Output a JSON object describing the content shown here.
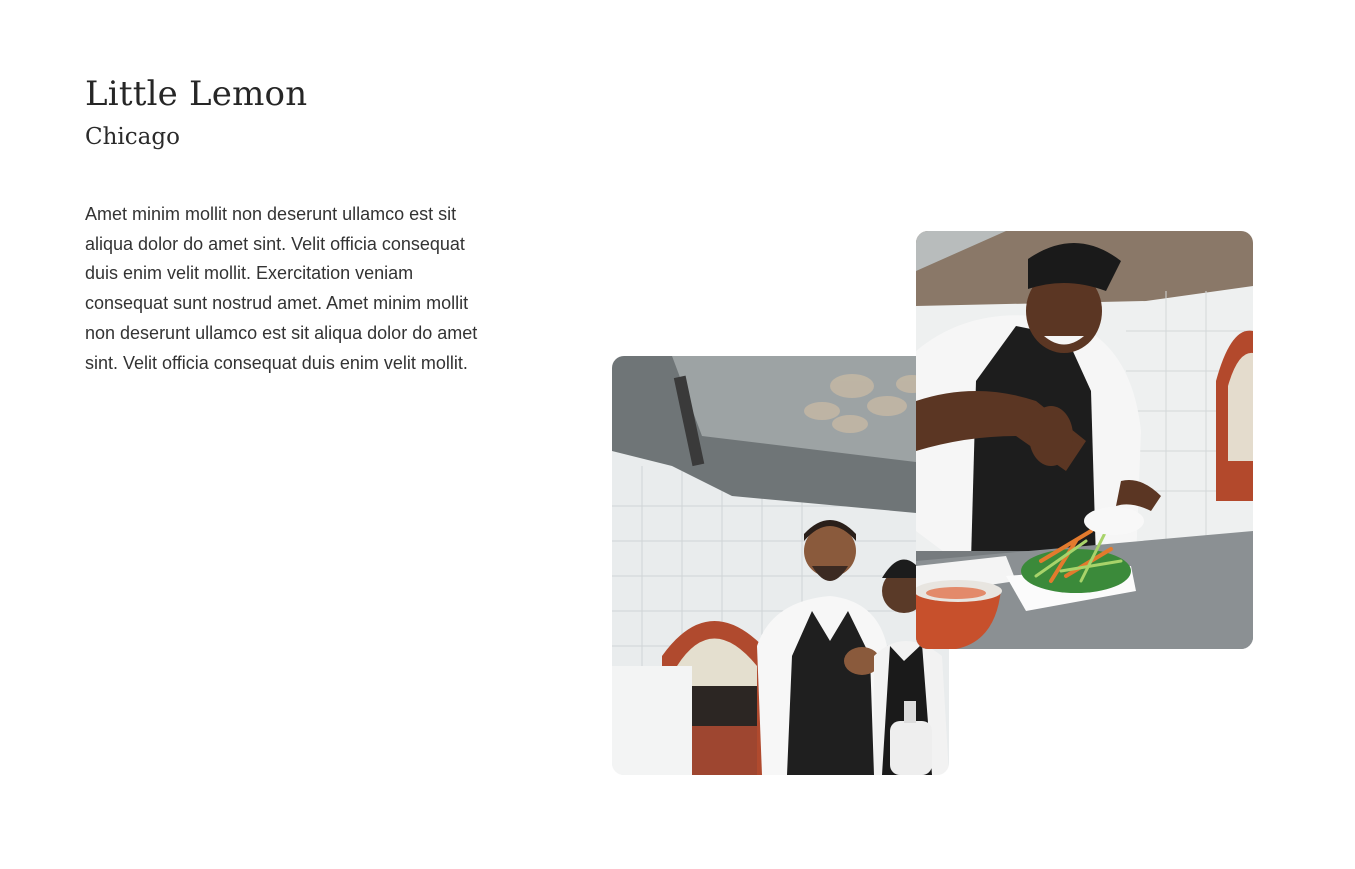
{
  "about": {
    "title": "Little Lemon",
    "subtitle": "Chicago",
    "description": "Amet minim mollit non deserunt ullamco est sit aliqua dolor do amet sint. Velit officia consequat duis enim velit mollit. Exercitation veniam consequat sunt nostrud amet. Amet minim mollit non deserunt ullamco est sit aliqua dolor do amet sint. Velit officia consequat duis enim velit mollit."
  },
  "images": [
    {
      "name": "chefs-laughing-photo"
    },
    {
      "name": "chef-plating-salad-photo"
    }
  ]
}
